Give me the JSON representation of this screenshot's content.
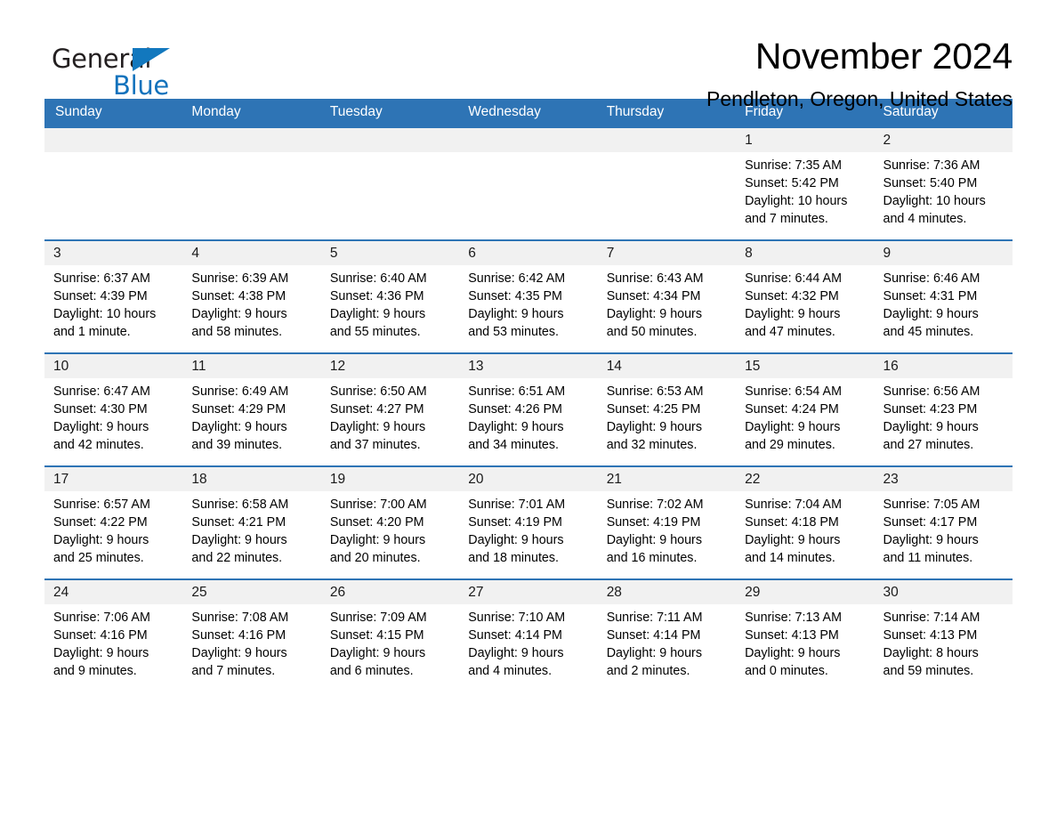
{
  "brand": {
    "name_part1": "General",
    "name_part2": "Blue",
    "accent_color": "#1272bc",
    "logo_icon": "triangle-flag-icon"
  },
  "header": {
    "title": "November 2024",
    "location": "Pendleton, Oregon, United States"
  },
  "calendar": {
    "header_bg": "#2e74b5",
    "daynum_bg": "#f1f1f1",
    "weekdays": [
      "Sunday",
      "Monday",
      "Tuesday",
      "Wednesday",
      "Thursday",
      "Friday",
      "Saturday"
    ],
    "weeks": [
      [
        {
          "day": "",
          "blank": true,
          "sunrise": "",
          "sunset": "",
          "daylight1": "",
          "daylight2": ""
        },
        {
          "day": "",
          "blank": true,
          "sunrise": "",
          "sunset": "",
          "daylight1": "",
          "daylight2": ""
        },
        {
          "day": "",
          "blank": true,
          "sunrise": "",
          "sunset": "",
          "daylight1": "",
          "daylight2": ""
        },
        {
          "day": "",
          "blank": true,
          "sunrise": "",
          "sunset": "",
          "daylight1": "",
          "daylight2": ""
        },
        {
          "day": "",
          "blank": true,
          "sunrise": "",
          "sunset": "",
          "daylight1": "",
          "daylight2": ""
        },
        {
          "day": "1",
          "blank": false,
          "sunrise": "Sunrise: 7:35 AM",
          "sunset": "Sunset: 5:42 PM",
          "daylight1": "Daylight: 10 hours",
          "daylight2": "and 7 minutes."
        },
        {
          "day": "2",
          "blank": false,
          "sunrise": "Sunrise: 7:36 AM",
          "sunset": "Sunset: 5:40 PM",
          "daylight1": "Daylight: 10 hours",
          "daylight2": "and 4 minutes."
        }
      ],
      [
        {
          "day": "3",
          "blank": false,
          "sunrise": "Sunrise: 6:37 AM",
          "sunset": "Sunset: 4:39 PM",
          "daylight1": "Daylight: 10 hours",
          "daylight2": "and 1 minute."
        },
        {
          "day": "4",
          "blank": false,
          "sunrise": "Sunrise: 6:39 AM",
          "sunset": "Sunset: 4:38 PM",
          "daylight1": "Daylight: 9 hours",
          "daylight2": "and 58 minutes."
        },
        {
          "day": "5",
          "blank": false,
          "sunrise": "Sunrise: 6:40 AM",
          "sunset": "Sunset: 4:36 PM",
          "daylight1": "Daylight: 9 hours",
          "daylight2": "and 55 minutes."
        },
        {
          "day": "6",
          "blank": false,
          "sunrise": "Sunrise: 6:42 AM",
          "sunset": "Sunset: 4:35 PM",
          "daylight1": "Daylight: 9 hours",
          "daylight2": "and 53 minutes."
        },
        {
          "day": "7",
          "blank": false,
          "sunrise": "Sunrise: 6:43 AM",
          "sunset": "Sunset: 4:34 PM",
          "daylight1": "Daylight: 9 hours",
          "daylight2": "and 50 minutes."
        },
        {
          "day": "8",
          "blank": false,
          "sunrise": "Sunrise: 6:44 AM",
          "sunset": "Sunset: 4:32 PM",
          "daylight1": "Daylight: 9 hours",
          "daylight2": "and 47 minutes."
        },
        {
          "day": "9",
          "blank": false,
          "sunrise": "Sunrise: 6:46 AM",
          "sunset": "Sunset: 4:31 PM",
          "daylight1": "Daylight: 9 hours",
          "daylight2": "and 45 minutes."
        }
      ],
      [
        {
          "day": "10",
          "blank": false,
          "sunrise": "Sunrise: 6:47 AM",
          "sunset": "Sunset: 4:30 PM",
          "daylight1": "Daylight: 9 hours",
          "daylight2": "and 42 minutes."
        },
        {
          "day": "11",
          "blank": false,
          "sunrise": "Sunrise: 6:49 AM",
          "sunset": "Sunset: 4:29 PM",
          "daylight1": "Daylight: 9 hours",
          "daylight2": "and 39 minutes."
        },
        {
          "day": "12",
          "blank": false,
          "sunrise": "Sunrise: 6:50 AM",
          "sunset": "Sunset: 4:27 PM",
          "daylight1": "Daylight: 9 hours",
          "daylight2": "and 37 minutes."
        },
        {
          "day": "13",
          "blank": false,
          "sunrise": "Sunrise: 6:51 AM",
          "sunset": "Sunset: 4:26 PM",
          "daylight1": "Daylight: 9 hours",
          "daylight2": "and 34 minutes."
        },
        {
          "day": "14",
          "blank": false,
          "sunrise": "Sunrise: 6:53 AM",
          "sunset": "Sunset: 4:25 PM",
          "daylight1": "Daylight: 9 hours",
          "daylight2": "and 32 minutes."
        },
        {
          "day": "15",
          "blank": false,
          "sunrise": "Sunrise: 6:54 AM",
          "sunset": "Sunset: 4:24 PM",
          "daylight1": "Daylight: 9 hours",
          "daylight2": "and 29 minutes."
        },
        {
          "day": "16",
          "blank": false,
          "sunrise": "Sunrise: 6:56 AM",
          "sunset": "Sunset: 4:23 PM",
          "daylight1": "Daylight: 9 hours",
          "daylight2": "and 27 minutes."
        }
      ],
      [
        {
          "day": "17",
          "blank": false,
          "sunrise": "Sunrise: 6:57 AM",
          "sunset": "Sunset: 4:22 PM",
          "daylight1": "Daylight: 9 hours",
          "daylight2": "and 25 minutes."
        },
        {
          "day": "18",
          "blank": false,
          "sunrise": "Sunrise: 6:58 AM",
          "sunset": "Sunset: 4:21 PM",
          "daylight1": "Daylight: 9 hours",
          "daylight2": "and 22 minutes."
        },
        {
          "day": "19",
          "blank": false,
          "sunrise": "Sunrise: 7:00 AM",
          "sunset": "Sunset: 4:20 PM",
          "daylight1": "Daylight: 9 hours",
          "daylight2": "and 20 minutes."
        },
        {
          "day": "20",
          "blank": false,
          "sunrise": "Sunrise: 7:01 AM",
          "sunset": "Sunset: 4:19 PM",
          "daylight1": "Daylight: 9 hours",
          "daylight2": "and 18 minutes."
        },
        {
          "day": "21",
          "blank": false,
          "sunrise": "Sunrise: 7:02 AM",
          "sunset": "Sunset: 4:19 PM",
          "daylight1": "Daylight: 9 hours",
          "daylight2": "and 16 minutes."
        },
        {
          "day": "22",
          "blank": false,
          "sunrise": "Sunrise: 7:04 AM",
          "sunset": "Sunset: 4:18 PM",
          "daylight1": "Daylight: 9 hours",
          "daylight2": "and 14 minutes."
        },
        {
          "day": "23",
          "blank": false,
          "sunrise": "Sunrise: 7:05 AM",
          "sunset": "Sunset: 4:17 PM",
          "daylight1": "Daylight: 9 hours",
          "daylight2": "and 11 minutes."
        }
      ],
      [
        {
          "day": "24",
          "blank": false,
          "sunrise": "Sunrise: 7:06 AM",
          "sunset": "Sunset: 4:16 PM",
          "daylight1": "Daylight: 9 hours",
          "daylight2": "and 9 minutes."
        },
        {
          "day": "25",
          "blank": false,
          "sunrise": "Sunrise: 7:08 AM",
          "sunset": "Sunset: 4:16 PM",
          "daylight1": "Daylight: 9 hours",
          "daylight2": "and 7 minutes."
        },
        {
          "day": "26",
          "blank": false,
          "sunrise": "Sunrise: 7:09 AM",
          "sunset": "Sunset: 4:15 PM",
          "daylight1": "Daylight: 9 hours",
          "daylight2": "and 6 minutes."
        },
        {
          "day": "27",
          "blank": false,
          "sunrise": "Sunrise: 7:10 AM",
          "sunset": "Sunset: 4:14 PM",
          "daylight1": "Daylight: 9 hours",
          "daylight2": "and 4 minutes."
        },
        {
          "day": "28",
          "blank": false,
          "sunrise": "Sunrise: 7:11 AM",
          "sunset": "Sunset: 4:14 PM",
          "daylight1": "Daylight: 9 hours",
          "daylight2": "and 2 minutes."
        },
        {
          "day": "29",
          "blank": false,
          "sunrise": "Sunrise: 7:13 AM",
          "sunset": "Sunset: 4:13 PM",
          "daylight1": "Daylight: 9 hours",
          "daylight2": "and 0 minutes."
        },
        {
          "day": "30",
          "blank": false,
          "sunrise": "Sunrise: 7:14 AM",
          "sunset": "Sunset: 4:13 PM",
          "daylight1": "Daylight: 8 hours",
          "daylight2": "and 59 minutes."
        }
      ]
    ]
  }
}
